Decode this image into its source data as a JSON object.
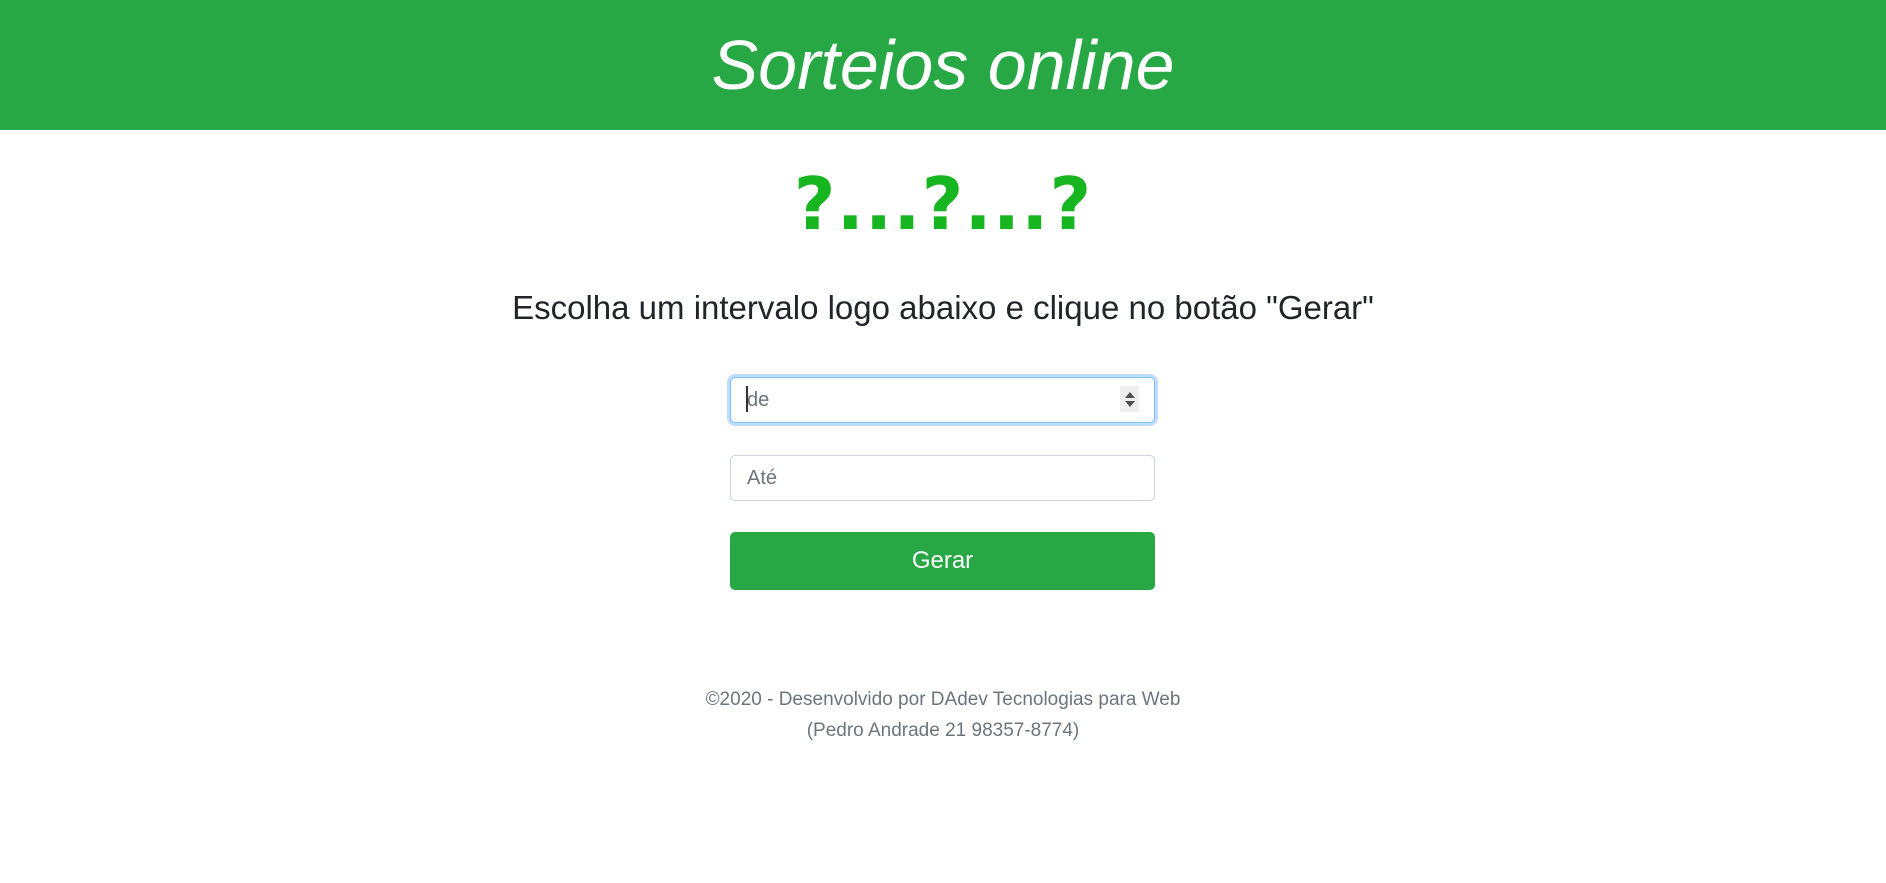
{
  "header": {
    "title": "Sorteios online"
  },
  "result": {
    "value": "?...?...?"
  },
  "instructions": "Escolha um intervalo logo abaixo e clique no botão \"Gerar\"",
  "form": {
    "from_placeholder": "de",
    "from_value": "",
    "to_placeholder": "Até",
    "to_value": "",
    "generate_label": "Gerar"
  },
  "footer": {
    "line1": "©2020 - Desenvolvido por DAdev Tecnologias para Web",
    "line2": "(Pedro Andrade 21 98357-8774)"
  },
  "colors": {
    "brand": "#28a745",
    "result": "#17b51f",
    "muted": "#6c757d"
  }
}
